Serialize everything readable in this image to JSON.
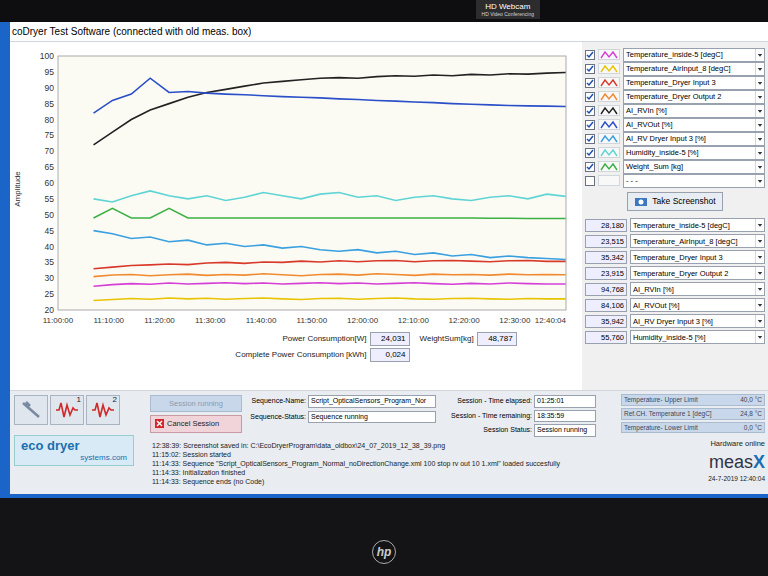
{
  "bezel": {
    "webcam_title": "HD Webcam",
    "webcam_subtitle": "HD Video Conferencing",
    "brand": "hp"
  },
  "window": {
    "title": "coDryer Test Software (connected with old meas. box)"
  },
  "chart": {
    "y_axis_label": "Amplitude",
    "y_min": 20,
    "y_max": 100,
    "y_ticks": [
      "100",
      "95",
      "90",
      "85",
      "80",
      "75",
      "70",
      "65",
      "60",
      "55",
      "50",
      "45",
      "40",
      "35",
      "30",
      "25",
      "20"
    ],
    "x_min_minutes": 0,
    "x_max_minutes": 100.07,
    "x_ticks": [
      {
        "label": "11:00:00",
        "minute": 0
      },
      {
        "label": "11:10:00",
        "minute": 10
      },
      {
        "label": "11:20:00",
        "minute": 20
      },
      {
        "label": "11:30:00",
        "minute": 30
      },
      {
        "label": "11:40:00",
        "minute": 40
      },
      {
        "label": "11:50:00",
        "minute": 50
      },
      {
        "label": "12:00:00",
        "minute": 60
      },
      {
        "label": "12:10:00",
        "minute": 70
      },
      {
        "label": "12:20:00",
        "minute": 80
      },
      {
        "label": "12:30:00",
        "minute": 90
      },
      {
        "label": "12:40:04",
        "minute": 100.07
      }
    ],
    "series": [
      {
        "label": "Temperature_inside-5 [degC]",
        "checked": true,
        "color": "#d63fd6",
        "start_minute": 7,
        "step_minutes": 3.72,
        "values": [
          27.5,
          28,
          28.3,
          28.1,
          28.5,
          28.2,
          28.4,
          28.6,
          28.3,
          28.5,
          28.2,
          28.4,
          28.6,
          28.3,
          28.5,
          28.2,
          28.4,
          28.6,
          28.3,
          28.1,
          28.4,
          28.2,
          28.5,
          28.3,
          28.2,
          28.2
        ]
      },
      {
        "label": "Temperature_AirInput_8 [degC]",
        "checked": true,
        "color": "#e8c400",
        "start_minute": 7,
        "step_minutes": 3.72,
        "values": [
          23,
          23.3,
          23.6,
          23.4,
          23.8,
          23.5,
          23.7,
          23.4,
          23.6,
          23.8,
          23.5,
          23.3,
          23.6,
          23.7,
          23.4,
          23.6,
          23.8,
          23.5,
          23.4,
          23.6,
          23.7,
          23.5,
          23.4,
          23.6,
          23.5,
          23.5
        ]
      },
      {
        "label": "Temperature_Dryer Input 3",
        "checked": true,
        "color": "#d83a2a",
        "start_minute": 7,
        "step_minutes": 3.72,
        "values": [
          33,
          33.5,
          34,
          34.2,
          34.5,
          34.3,
          34.8,
          35,
          34.7,
          35.1,
          35,
          35.4,
          35.1,
          35.5,
          35.2,
          35.5,
          35.6,
          35.2,
          35.5,
          35.6,
          35.4,
          35.2,
          35.5,
          35.6,
          35.3,
          35.3
        ]
      },
      {
        "label": "Temperature_Dryer Output 2",
        "checked": true,
        "color": "#f08a30",
        "start_minute": 7,
        "step_minutes": 3.72,
        "values": [
          30.5,
          31,
          31.2,
          30.8,
          31.1,
          31.3,
          30.9,
          31.2,
          31,
          31.4,
          31.1,
          30.8,
          31.2,
          31.3,
          31,
          31.4,
          31.2,
          30.9,
          31.3,
          31.1,
          31.2,
          31,
          31.3,
          31.1,
          31.2,
          31.1
        ]
      },
      {
        "label": "AI_RVIn [%]",
        "checked": true,
        "color": "#222222",
        "start_minute": 7,
        "step_minutes": 3.72,
        "values": [
          72,
          76,
          80,
          83,
          85,
          87,
          88.5,
          89.5,
          90.5,
          91.5,
          92,
          92.5,
          93,
          93.2,
          93,
          93.5,
          93.8,
          93.6,
          94,
          93.8,
          94.2,
          94,
          94.4,
          94.3,
          94.6,
          94.8
        ]
      },
      {
        "label": "AI_RVOut [%]",
        "checked": true,
        "color": "#2a4fc8",
        "start_minute": 7,
        "step_minutes": 3.72,
        "values": [
          82,
          86,
          88,
          93,
          88.5,
          88.8,
          88.3,
          88,
          87.8,
          87.5,
          87.2,
          87,
          86.8,
          86.5,
          86.3,
          86,
          85.8,
          85.5,
          85.3,
          85,
          84.8,
          84.6,
          84.4,
          84.3,
          84.2,
          84.1
        ]
      },
      {
        "label": "AI_RV Dryer Input 3 [%]",
        "checked": true,
        "color": "#3aa0e0",
        "start_minute": 7,
        "step_minutes": 3.72,
        "values": [
          45,
          44,
          42.5,
          43,
          41.5,
          42,
          40.5,
          41,
          40,
          40.5,
          39.5,
          40,
          39,
          38.5,
          39,
          38,
          38.5,
          37.5,
          38,
          37,
          37.5,
          36.5,
          37,
          36.5,
          36.2,
          35.9
        ]
      },
      {
        "label": "Humidity_inside-5 [%]",
        "checked": true,
        "color": "#5fd4d4",
        "start_minute": 7,
        "step_minutes": 3.72,
        "values": [
          55,
          54,
          56,
          57.5,
          56,
          55,
          56,
          54.5,
          55.5,
          57,
          56,
          55,
          56.5,
          57,
          55.5,
          56,
          54.5,
          55.5,
          56,
          55,
          54.5,
          55.5,
          56,
          55,
          56.5,
          55.8
        ]
      },
      {
        "label": "Weight_Sum [kg]",
        "checked": true,
        "color": "#3cb043",
        "start_minute": 7,
        "step_minutes": 3.72,
        "values": [
          49,
          52,
          49,
          49,
          52,
          49,
          49,
          49,
          49,
          49,
          49,
          49,
          49,
          49,
          49,
          49,
          49,
          49,
          49,
          49,
          49,
          48.9,
          48.9,
          48.8,
          48.8,
          48.8
        ]
      }
    ],
    "legend_extra": [
      {
        "label": "- - -",
        "checked": false
      }
    ]
  },
  "take_screenshot": "Take Screenshot",
  "readings": [
    {
      "value": "28,180",
      "name": "Temperature_inside-5 [degC]"
    },
    {
      "value": "23,515",
      "name": "Temperature_AirInput_8 [degC]"
    },
    {
      "value": "35,342",
      "name": "Temperature_Dryer Input 3"
    },
    {
      "value": "23,915",
      "name": "Temperature_Dryer Output 2"
    },
    {
      "value": "94,768",
      "name": "AI_RVIn [%]"
    },
    {
      "value": "84,106",
      "name": "AI_RVOut [%]"
    },
    {
      "value": "35,942",
      "name": "AI_RV Dryer Input 3 [%]"
    },
    {
      "value": "55,760",
      "name": "Humidity_inside-5 [%]"
    }
  ],
  "stats": [
    {
      "label": "Power Consumption[W]",
      "value": "24,031"
    },
    {
      "label": "WeightSum[kg]",
      "value": "48,787"
    },
    {
      "label": "Complete Power Consumption [kWh]",
      "value": "0,024"
    }
  ],
  "toolbar": [
    {
      "kind": "tool",
      "badge": ""
    },
    {
      "kind": "wave",
      "badge": "1"
    },
    {
      "kind": "wave",
      "badge": "2"
    }
  ],
  "session_buttons": [
    {
      "label": "Session running",
      "disabled": true
    },
    {
      "label": "Cancel Session",
      "disabled": false
    }
  ],
  "sequence": [
    {
      "label": "Sequence-Name:",
      "value": "Script_OpticalSensors_Program_Nor"
    },
    {
      "label": "Sequence-Status:",
      "value": "Sequence running"
    }
  ],
  "session": [
    {
      "label": "Session - Time elapsed:",
      "value": "01:25:01"
    },
    {
      "label": "Session - Time remaining:",
      "value": "18:35:59"
    },
    {
      "label": "Session Status:",
      "value": "Session running"
    }
  ],
  "limits": [
    {
      "label": "Temperature- Upper Limit",
      "value": "40,0 °C"
    },
    {
      "label": "Ref.CH. Temperature 1 [degC]",
      "value": "24,8 °C"
    },
    {
      "label": "Temperature- Lower Limit",
      "value": "0,0 °C"
    }
  ],
  "log": [
    "12:38:39: Screenshot saved in: C:\\EcoDryerProgram\\data_oldbox\\24_07_2019_12_38_39.png",
    "11:15:02: Session started",
    "11:14:33: Sequence \"Script_OpticalSensors_Program_Normal_noDirectionChange.xml 100 stop rv out 10 1.xml\" loaded succesfully",
    "11:14:33: Initialization finished",
    "11:14:33: Sequence ends (no Code)"
  ],
  "logo": {
    "line1": "eco dryer",
    "line2": "systems.com"
  },
  "hardware": "Hardware online",
  "vendor": {
    "text": "meas",
    "accent": "X"
  },
  "timestamp": "24-7-2019 12:40:04"
}
